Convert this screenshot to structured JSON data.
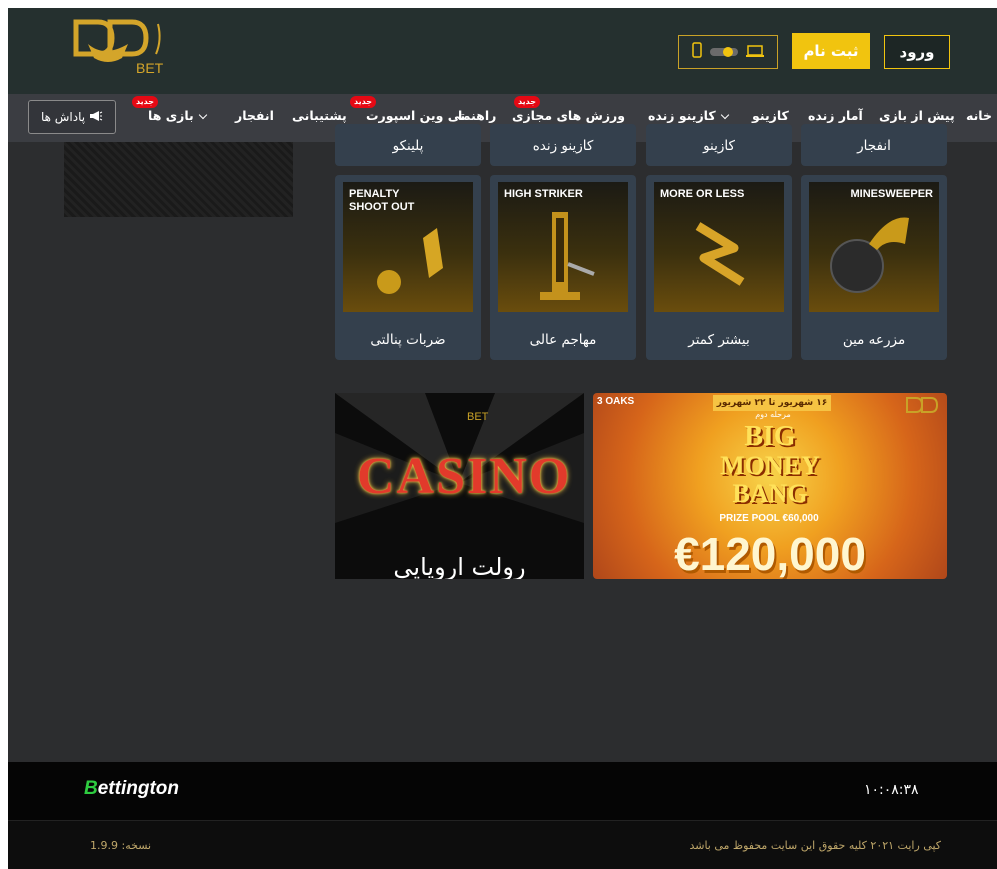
{
  "header": {
    "login_label": "ورود",
    "register_label": "ثبت نام",
    "logo_text": "BET"
  },
  "nav": {
    "items": [
      {
        "label": "خانه"
      },
      {
        "label": "پیش از بازی"
      },
      {
        "label": "آمار زنده"
      },
      {
        "label": "کازینو"
      },
      {
        "label": "کازینو زنده"
      },
      {
        "label": "ورزش های مجازی",
        "badge": "جدید"
      },
      {
        "label": "راهنما"
      },
      {
        "label": "تی وین اسپورت",
        "badge": "جدید"
      },
      {
        "label": "پشتیبانی"
      },
      {
        "label": "انفجار"
      },
      {
        "label": "بازی ها",
        "badge": "جدید"
      }
    ],
    "rewards_label": "پاداش ها"
  },
  "game_tiles_row1": [
    {
      "name": "انفجار"
    },
    {
      "name": "کازینو"
    },
    {
      "name": "کازینو زنده"
    },
    {
      "name": "پلینکو"
    }
  ],
  "game_tiles_row2": [
    {
      "name": "مزرعه مین",
      "image_title": "MINESWEEPER"
    },
    {
      "name": "بیشتر کمتر",
      "image_title": "MORE OR LESS"
    },
    {
      "name": "مهاجم عالی",
      "image_title": "HIGH STRIKER"
    },
    {
      "name": "ضربات پنالتی",
      "image_title": "PENALTY SHOOT OUT"
    }
  ],
  "promos": {
    "casino": {
      "title": "CASINO",
      "subtitle": "رولت اروپایی",
      "logo": "BET"
    },
    "money": {
      "provider": "3 OAKS",
      "dates": "۱۶ شهریور تا ۲۲ شهریور",
      "stage": "مرحله دوم",
      "line1": "BIG",
      "line2": "MONEY",
      "line3": "BANG",
      "prize_pool": "PRIZE POOL €60,000",
      "amount": "€120,000"
    }
  },
  "footer": {
    "brand_first": "B",
    "brand_rest": "ettington",
    "clock": "۱۰:۰۸:۳۸",
    "copyright": "کپی رایت ۲۰۲۱ کلیه حقوق این سایت محفوظ می باشد",
    "version": "نسخه: 1.9.9"
  },
  "colors": {
    "accent": "#f1c40f",
    "header_bg": "#25302f",
    "nav_bg": "#3b3d42",
    "tile_bg": "#34404d",
    "badge": "#e50914"
  }
}
